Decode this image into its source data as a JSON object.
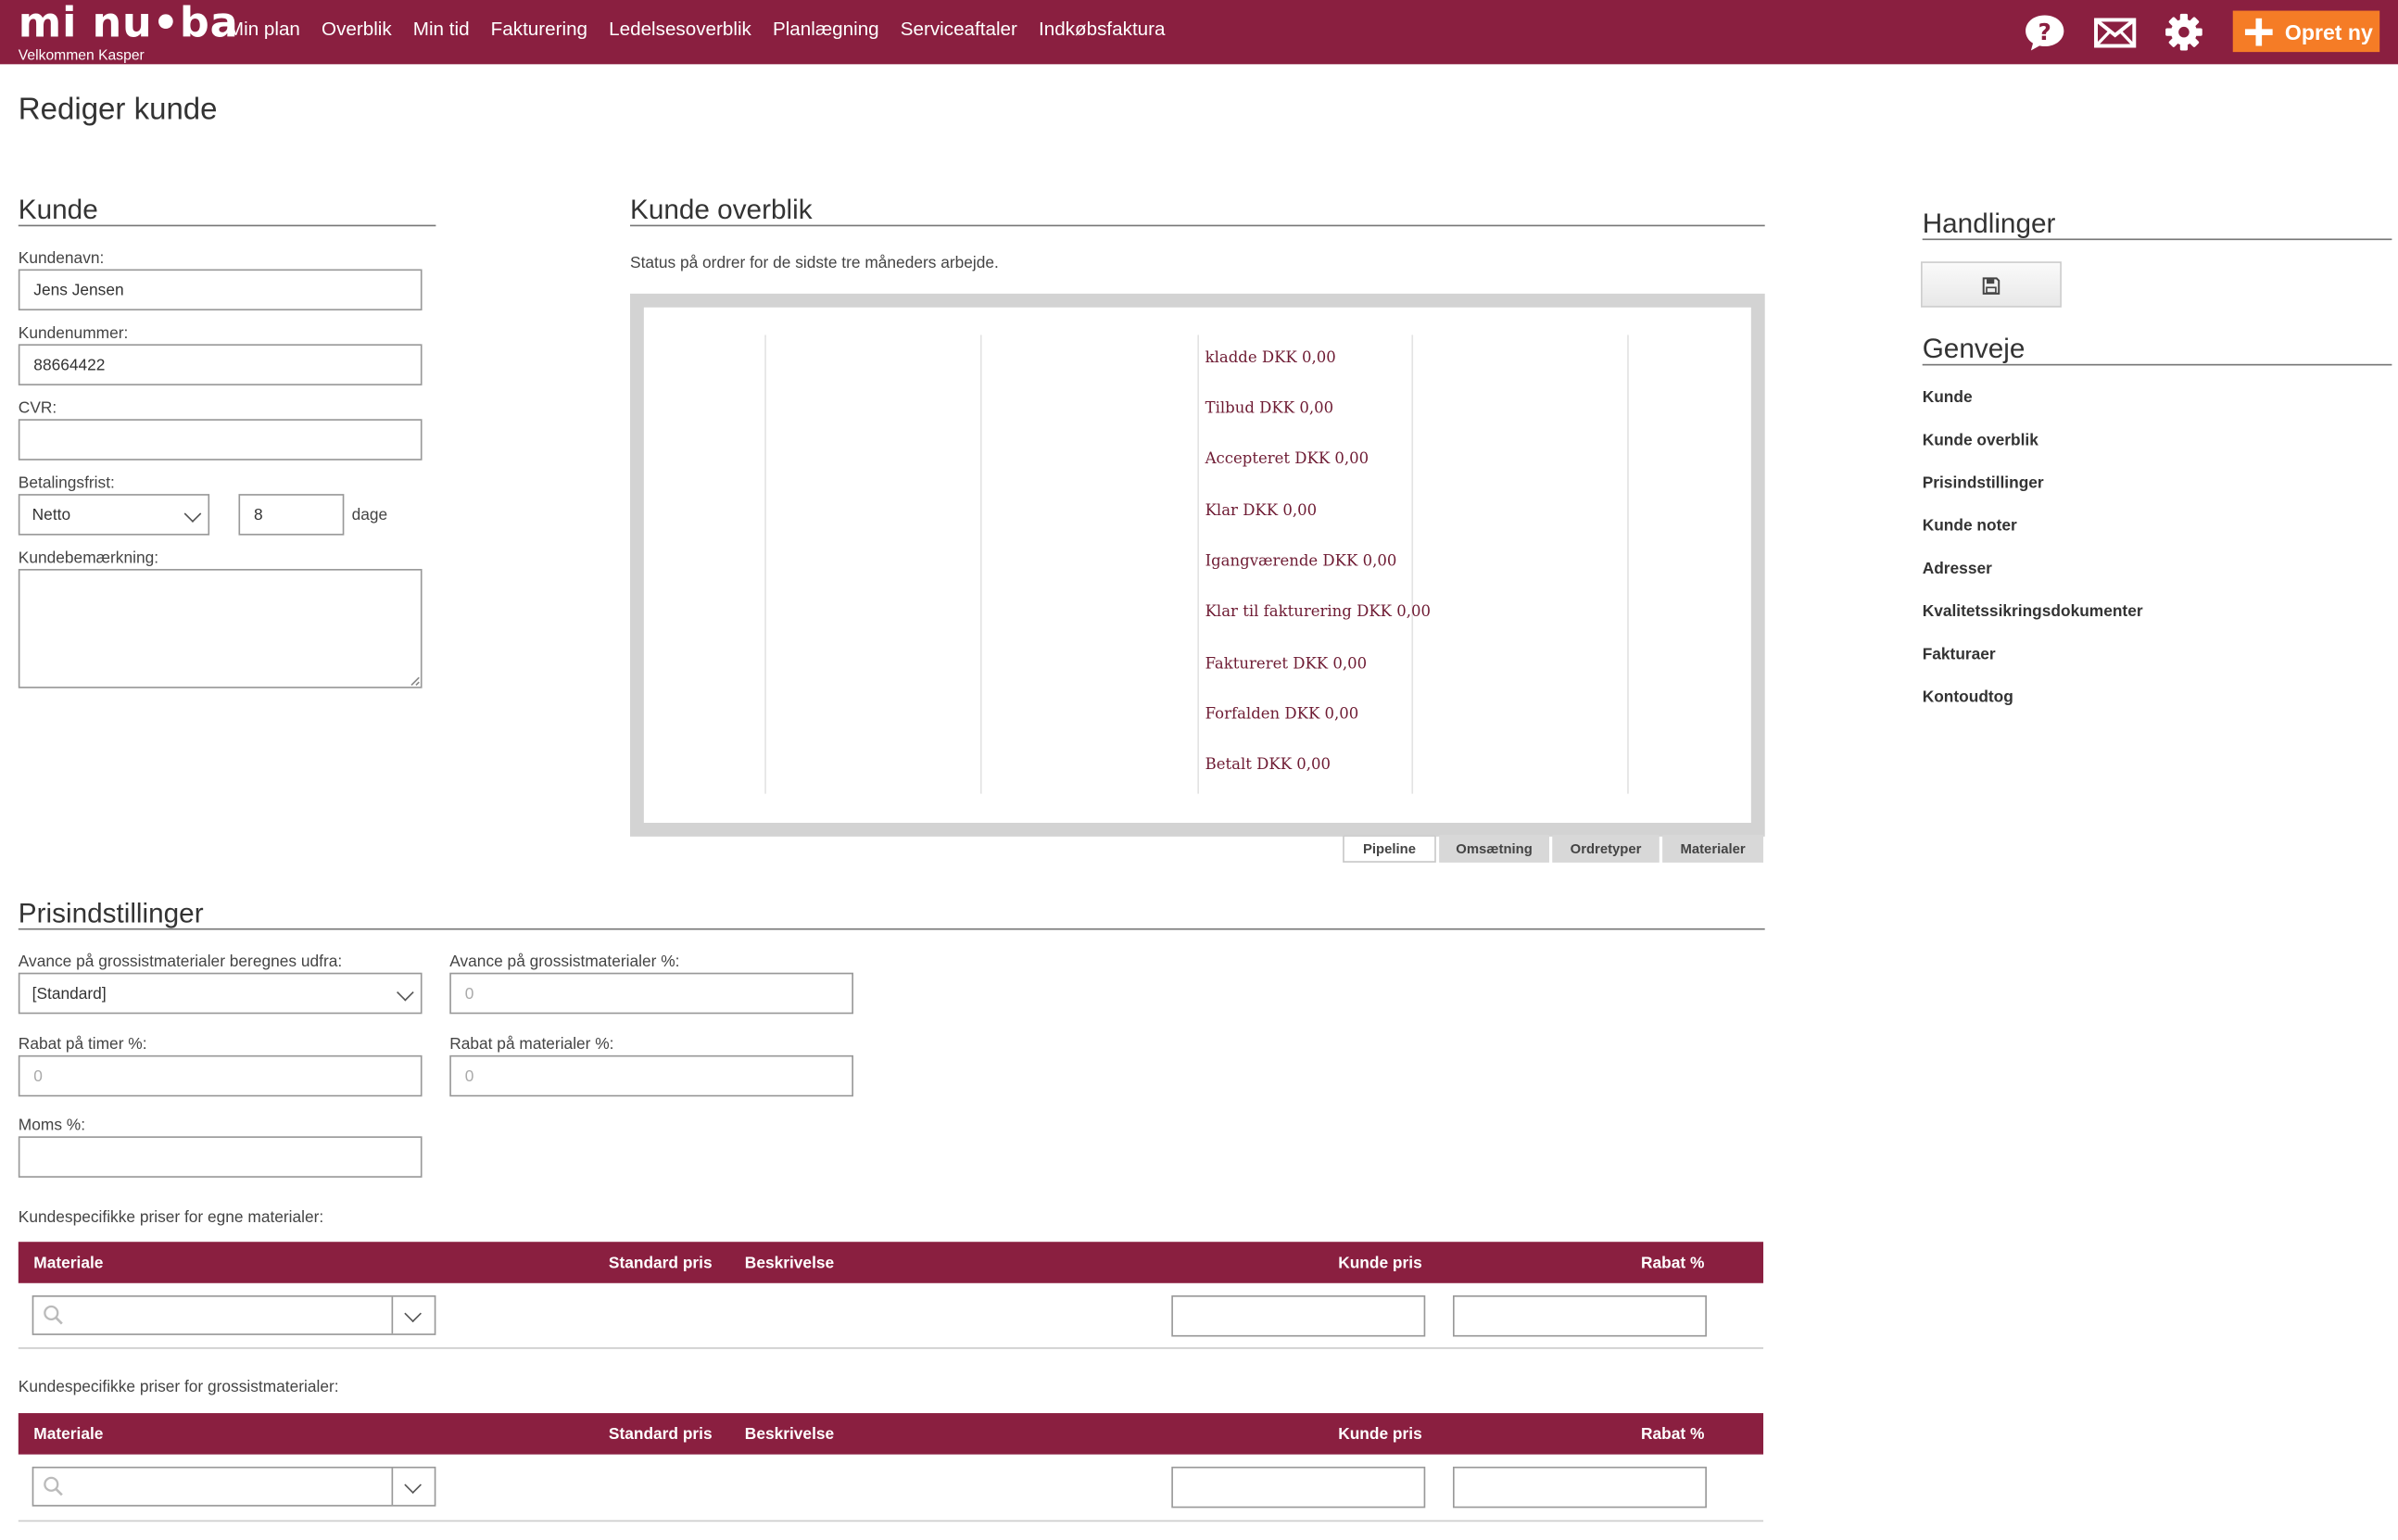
{
  "app": {
    "logo": "mi nu•ba",
    "welcome": "Velkommen  Kasper",
    "nav": [
      "Min plan",
      "Overblik",
      "Min tid",
      "Fakturering",
      "Ledelsesoverblik",
      "Planlægning",
      "Serviceaftaler",
      "Indkøbsfaktura"
    ],
    "create_label": "Opret ny",
    "icons": [
      "help-icon",
      "mail-icon",
      "settings-icon",
      "plus-icon"
    ]
  },
  "page": {
    "title": "Rediger kunde"
  },
  "kunde": {
    "title": "Kunde",
    "name_label": "Kundenavn:",
    "name_value": "Jens Jensen",
    "number_label": "Kundenummer:",
    "number_value": "88664422",
    "cvr_label": "CVR:",
    "cvr_value": "",
    "payment_label": "Betalingsfrist:",
    "payment_select": "Netto",
    "payment_days": "8",
    "payment_unit": "dage",
    "note_label": "Kundebemærkning:",
    "note_value": ""
  },
  "overblik": {
    "title": "Kunde overblik",
    "description": "Status på ordrer for de sidste tre måneders arbejde.",
    "statuses": [
      "kladde DKK 0,00",
      "Tilbud DKK 0,00",
      "Accepteret DKK 0,00",
      "Klar DKK 0,00",
      "Igangværende DKK 0,00",
      "Klar til fakturering DKK 0,00",
      "Faktureret DKK 0,00",
      "Forfalden DKK 0,00",
      "Betalt DKK 0,00"
    ],
    "tabs": [
      "Pipeline",
      "Omsætning",
      "Ordretyper",
      "Materialer"
    ],
    "active_tab": "Pipeline"
  },
  "chart_data": {
    "type": "bar",
    "categories": [
      "kladde",
      "Tilbud",
      "Accepteret",
      "Klar",
      "Igangværende",
      "Klar til fakturering",
      "Faktureret",
      "Forfalden",
      "Betalt"
    ],
    "values": [
      0,
      0,
      0,
      0,
      0,
      0,
      0,
      0,
      0
    ],
    "title": "",
    "xlabel": "",
    "ylabel": ""
  },
  "handlinger": {
    "title": "Handlinger",
    "save_icon": "save-icon"
  },
  "genveje": {
    "title": "Genveje",
    "items": [
      "Kunde",
      "Kunde overblik",
      "Prisindstillinger",
      "Kunde noter",
      "Adresser",
      "Kvalitetssikringsdokumenter",
      "Fakturaer",
      "Kontoudtog"
    ]
  },
  "pris": {
    "title": "Prisindstillinger",
    "avance_basis_label": "Avance på grossistmaterialer beregnes udfra:",
    "avance_basis_value": "[Standard]",
    "avance_pct_label": "Avance på grossistmaterialer %:",
    "avance_pct_placeholder": "0",
    "rabat_timer_label": "Rabat på timer %:",
    "rabat_timer_placeholder": "0",
    "rabat_mat_label": "Rabat på materialer %:",
    "rabat_mat_placeholder": "0",
    "moms_label": "Moms %:",
    "moms_value": ""
  },
  "egne": {
    "caption": "Kundespecifikke priser for egne materialer:",
    "columns": [
      "Materiale",
      "Standard pris",
      "Beskrivelse",
      "Kunde pris",
      "Rabat %"
    ]
  },
  "grossist": {
    "caption": "Kundespecifikke priser for grossistmaterialer:",
    "columns": [
      "Materiale",
      "Standard pris",
      "Beskrivelse",
      "Kunde pris",
      "Rabat %"
    ]
  }
}
